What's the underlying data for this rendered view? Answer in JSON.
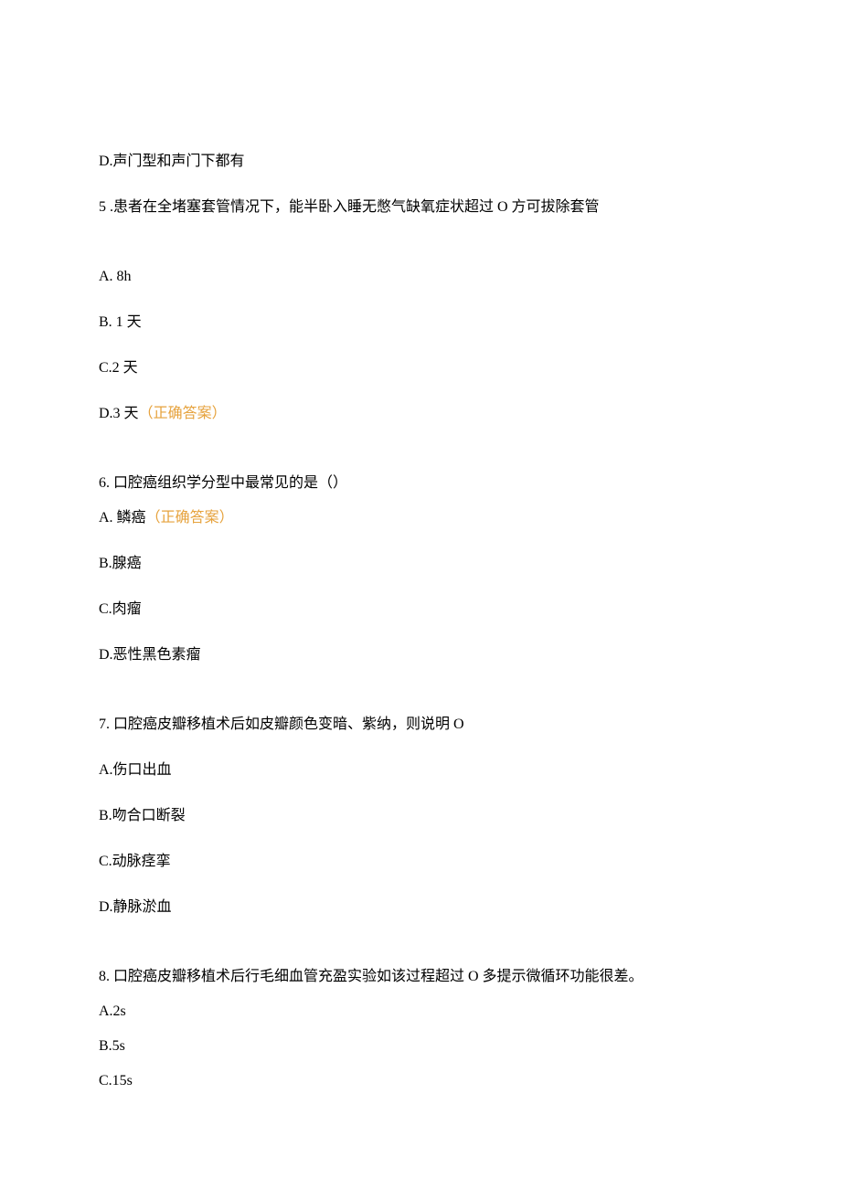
{
  "q4_option_d": "D.声门型和声门下都有",
  "q5": {
    "question": "5 .患者在全堵塞套管情况下，能半卧入睡无憋气缺氧症状超过 O 方可拔除套管",
    "opt_a": "A.   8h",
    "opt_b": "B.   1 天",
    "opt_c": "C.2 天",
    "opt_d": "D.3 天",
    "correct": "（正确答案）"
  },
  "q6": {
    "question": "6.   口腔癌组织学分型中最常见的是（）",
    "opt_a": "A. 鳞癌",
    "correct": "（正确答案）",
    "opt_b": "B.腺癌",
    "opt_c": "C.肉瘤",
    "opt_d": "D.恶性黑色素瘤"
  },
  "q7": {
    "question": "7.   口腔癌皮瓣移植术后如皮瓣颜色变暗、紫纳，则说明 O",
    "opt_a": "A.伤口出血",
    "opt_b": "B.吻合口断裂",
    "opt_c": "C.动脉痉挛",
    "opt_d": "D.静脉淤血"
  },
  "q8": {
    "question": "8.   口腔癌皮瓣移植术后行毛细血管充盈实验如该过程超过 O 多提示微循环功能很差。",
    "opt_a": "A.2s",
    "opt_b": "B.5s",
    "opt_c": "C.15s"
  }
}
